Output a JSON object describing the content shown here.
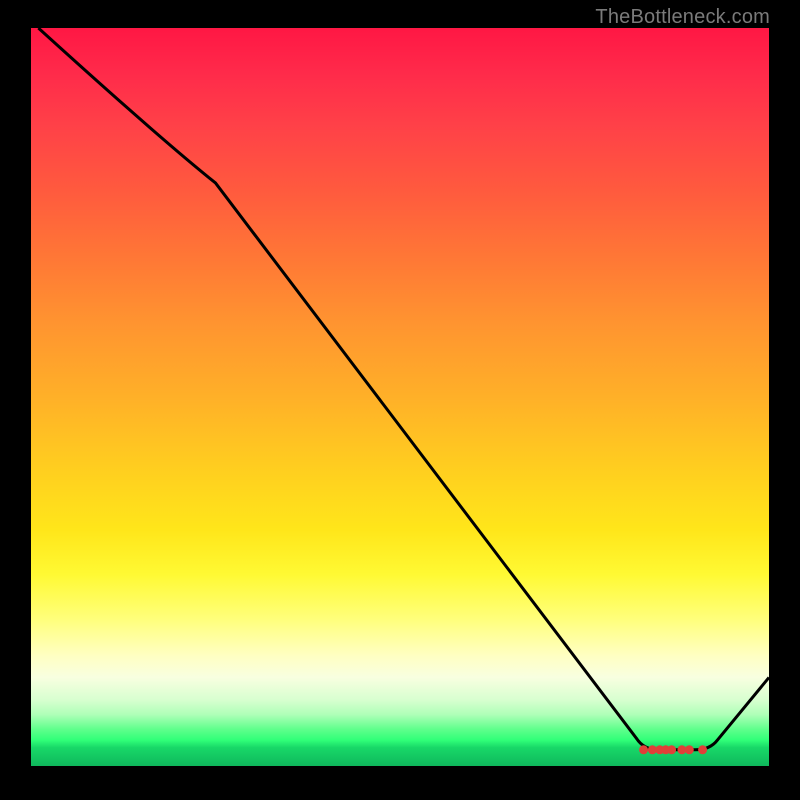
{
  "watermark": "TheBottleneck.com",
  "chart_data": {
    "type": "line",
    "title": "",
    "xlabel": "",
    "ylabel": "",
    "xlim": [
      0,
      100
    ],
    "ylim": [
      0,
      100
    ],
    "grid": false,
    "legend": null,
    "curve": [
      {
        "x": 1,
        "y": 100
      },
      {
        "x": 25,
        "y": 79
      },
      {
        "x": 83,
        "y": 2.2
      },
      {
        "x": 85,
        "y": 2.2
      },
      {
        "x": 91,
        "y": 2.2
      },
      {
        "x": 100,
        "y": 12
      }
    ],
    "optimal_range_dots": [
      {
        "x": 83.0,
        "y": 2.2
      },
      {
        "x": 84.2,
        "y": 2.2
      },
      {
        "x": 85.2,
        "y": 2.2
      },
      {
        "x": 86.0,
        "y": 2.2
      },
      {
        "x": 86.8,
        "y": 2.2
      },
      {
        "x": 88.2,
        "y": 2.2
      },
      {
        "x": 89.2,
        "y": 2.2
      },
      {
        "x": 91.0,
        "y": 2.2
      }
    ],
    "dot_color": "#e04038"
  }
}
